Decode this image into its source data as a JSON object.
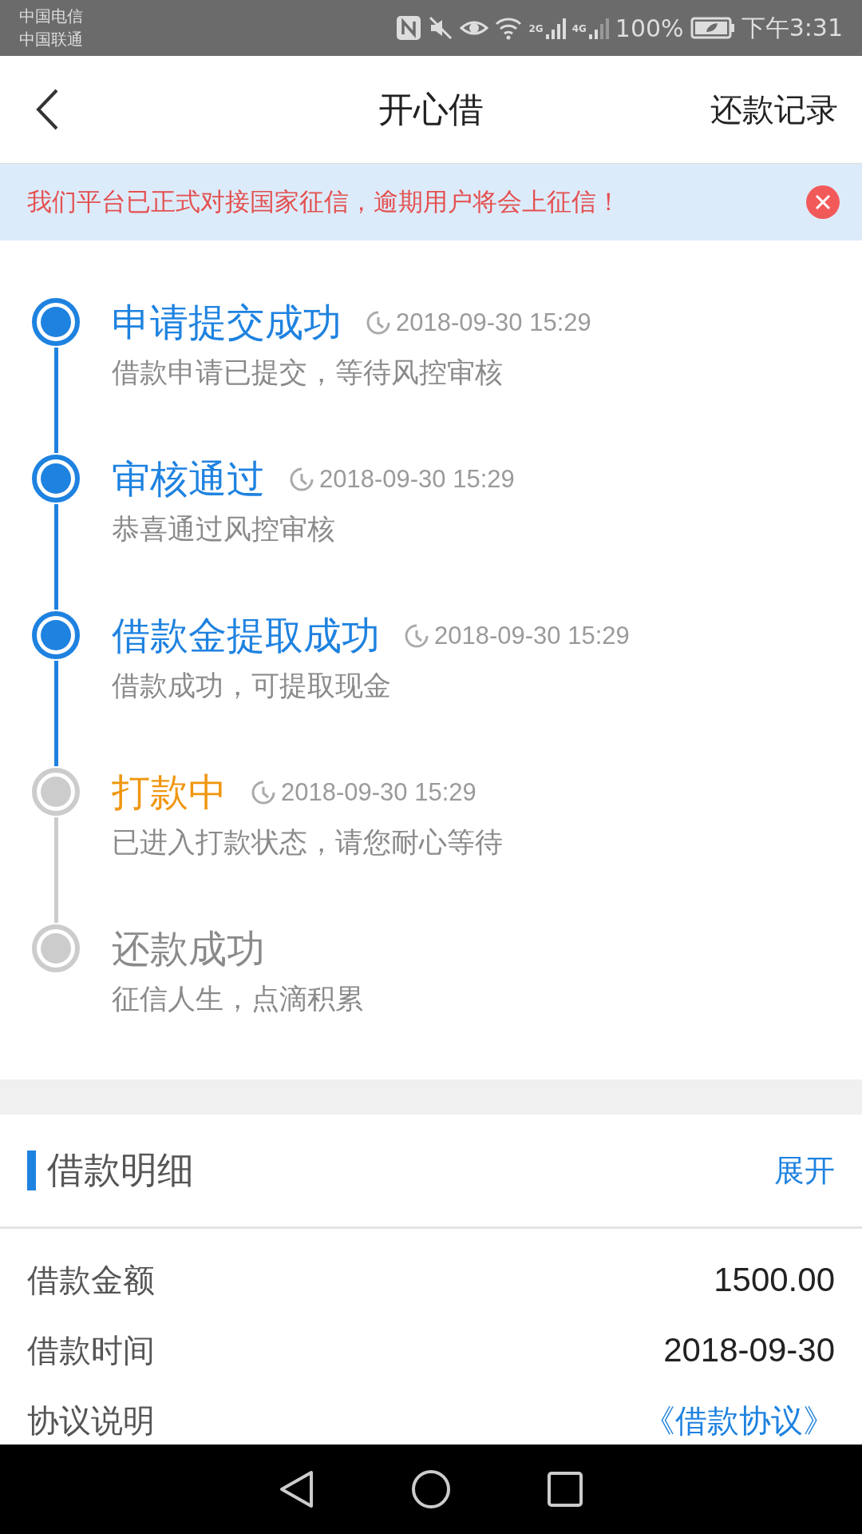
{
  "status_bar": {
    "carriers": [
      "中国电信",
      "中国联通"
    ],
    "network_1": "2G",
    "network_2": "4G",
    "battery": "100%",
    "time": "下午3:31"
  },
  "header": {
    "title": "开心借",
    "action": "还款记录"
  },
  "notice": {
    "text": "我们平台已正式对接国家征信，逾期用户将会上征信！"
  },
  "timeline": [
    {
      "kind": "done",
      "title": "申请提交成功",
      "time": "2018-09-30 15:29",
      "description": "借款申请已提交，等待风控审核"
    },
    {
      "kind": "done",
      "title": "审核通过",
      "time": "2018-09-30 15:29",
      "description": "恭喜通过风控审核"
    },
    {
      "kind": "done",
      "title": "借款金提取成功",
      "time": "2018-09-30 15:29",
      "description": "借款成功，可提取现金"
    },
    {
      "kind": "current",
      "title": "打款中",
      "time": "2018-09-30 15:29",
      "description": "已进入打款状态，请您耐心等待"
    },
    {
      "kind": "pending",
      "title": "还款成功",
      "description": "征信人生，点滴积累"
    }
  ],
  "details": {
    "title": "借款明细",
    "toggle": "展开",
    "rows": [
      {
        "kind": "text",
        "label": "借款金额",
        "value": "1500.00"
      },
      {
        "kind": "text",
        "label": "借款时间",
        "value": "2018-09-30"
      },
      {
        "kind": "link",
        "label": "协议说明",
        "value": "《借款协议》"
      }
    ]
  }
}
